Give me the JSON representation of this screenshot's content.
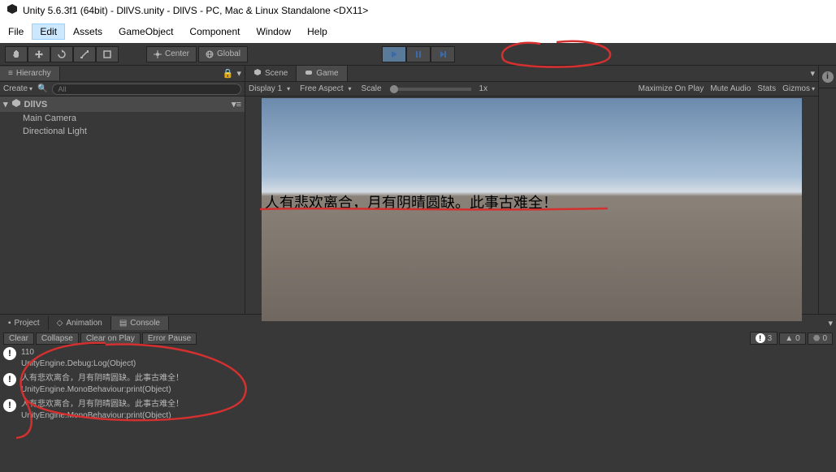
{
  "titlebar": {
    "text": "Unity 5.6.3f1 (64bit) - DllVS.unity - DllVS - PC, Mac & Linux Standalone <DX11>"
  },
  "menubar": {
    "items": [
      "File",
      "Edit",
      "Assets",
      "GameObject",
      "Component",
      "Window",
      "Help"
    ],
    "active": 1
  },
  "toolbar": {
    "center": "Center",
    "global": "Global"
  },
  "hierarchy": {
    "tab": "Hierarchy",
    "create": "Create",
    "search_placeholder": "All",
    "root": "DllVS",
    "children": [
      "Main Camera",
      "Directional Light"
    ]
  },
  "scene_tab": "Scene",
  "game_tab": "Game",
  "gameview": {
    "display": "Display 1",
    "aspect": "Free Aspect",
    "scale_label": "Scale",
    "scale_value": "1x",
    "maximize": "Maximize On Play",
    "mute": "Mute Audio",
    "stats": "Stats",
    "gizmos": "Gizmos",
    "overlay_text": "人有悲欢离合，月有阴晴圆缺。此事古难全！"
  },
  "bottom_tabs": {
    "project": "Project",
    "animation": "Animation",
    "console": "Console"
  },
  "console_toolbar": {
    "clear": "Clear",
    "collapse": "Collapse",
    "clear_on_play": "Clear on Play",
    "error_pause": "Error Pause",
    "info_count": "3",
    "warn_count": "0",
    "error_count": "0"
  },
  "console_entries": [
    {
      "line1": "110",
      "line2": "UnityEngine.Debug:Log(Object)"
    },
    {
      "line1": "人有悲欢离合，月有阴晴圆缺。此事古难全！",
      "line2": "UnityEngine.MonoBehaviour:print(Object)"
    },
    {
      "line1": "人有悲欢离合，月有阴晴圆缺。此事古难全！",
      "line2": "UnityEngine.MonoBehaviour:print(Object)"
    }
  ]
}
